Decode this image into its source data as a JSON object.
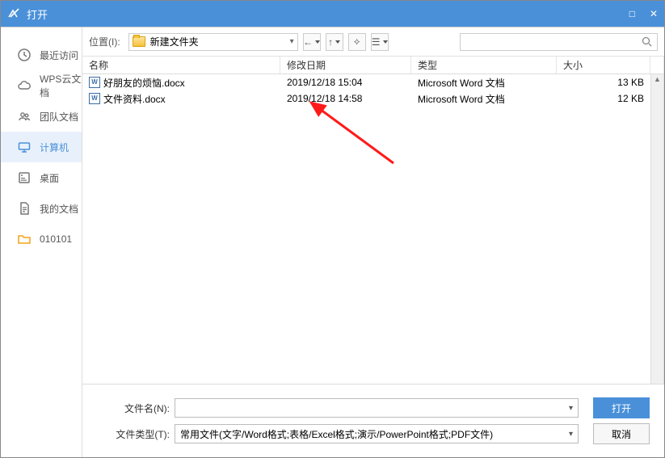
{
  "window": {
    "title": "打开"
  },
  "sidebar": {
    "items": [
      {
        "label": "最近访问",
        "icon": "clock"
      },
      {
        "label": "WPS云文档",
        "icon": "cloud"
      },
      {
        "label": "团队文档",
        "icon": "team"
      },
      {
        "label": "计算机",
        "icon": "computer",
        "active": true
      },
      {
        "label": "桌面",
        "icon": "desktop"
      },
      {
        "label": "我的文档",
        "icon": "doc"
      },
      {
        "label": "010101",
        "icon": "folder"
      }
    ]
  },
  "toolbar": {
    "location_label": "位置(I):",
    "location_value": "新建文件夹"
  },
  "columns": {
    "name": "名称",
    "date": "修改日期",
    "type": "类型",
    "size": "大小"
  },
  "files": [
    {
      "name": "好朋友的烦恼.docx",
      "date": "2019/12/18 15:04",
      "type": "Microsoft Word 文档",
      "size": "13 KB"
    },
    {
      "name": "文件资料.docx",
      "date": "2019/12/18 14:58",
      "type": "Microsoft Word 文档",
      "size": "12 KB"
    }
  ],
  "footer": {
    "filename_label": "文件名(N):",
    "filetype_label": "文件类型(T):",
    "filetype_value": "常用文件(文字/Word格式;表格/Excel格式;演示/PowerPoint格式;PDF文件)",
    "open": "打开",
    "cancel": "取消"
  }
}
